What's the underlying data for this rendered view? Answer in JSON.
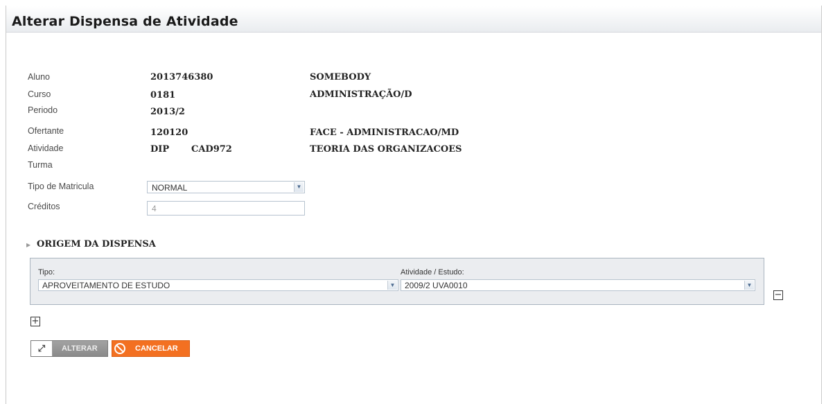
{
  "page": {
    "title": "Alterar Dispensa de Atividade"
  },
  "fields": {
    "aluno": {
      "label": "Aluno",
      "code": "2013746380",
      "name": "SOMEBODY"
    },
    "curso": {
      "label": "Curso",
      "code": "0181",
      "name": "ADMINISTRAÇÃO/D"
    },
    "periodo": {
      "label": "Periodo",
      "value": "2013/2"
    },
    "ofertante": {
      "label": "Ofertante",
      "code": "120120",
      "name": "FACE - ADMINISTRACAO/MD"
    },
    "atividade": {
      "label": "Atividade",
      "prefix": "DIP",
      "code": "CAD972",
      "name": "TEORIA DAS ORGANIZACOES"
    },
    "turma": {
      "label": "Turma"
    },
    "tipo_matricula": {
      "label": "Tipo de Matricula",
      "selected": "NORMAL"
    },
    "creditos": {
      "label": "Créditos",
      "value": "4"
    }
  },
  "origem": {
    "section_title": "ORIGEM DA DISPENSA",
    "tipo_label": "Tipo:",
    "tipo_selected": "APROVEITAMENTO DE ESTUDO",
    "atividade_label": "Atividade / Estudo:",
    "atividade_selected": "2009/2 UVA0010"
  },
  "buttons": {
    "alterar": "ALTERAR",
    "cancelar": "CANCELAR"
  },
  "icons": {
    "dropdown": "chevron-down-icon",
    "remove": "minus-box-icon",
    "add": "plus-box-icon",
    "alterar": "resize-arrows-icon",
    "cancelar": "no-entry-icon",
    "section": "triangle-right-icon"
  },
  "colors": {
    "cancel_button": "#f37021",
    "alterar_button": "#8f8f8f",
    "panel_bg": "#ebedf0"
  }
}
